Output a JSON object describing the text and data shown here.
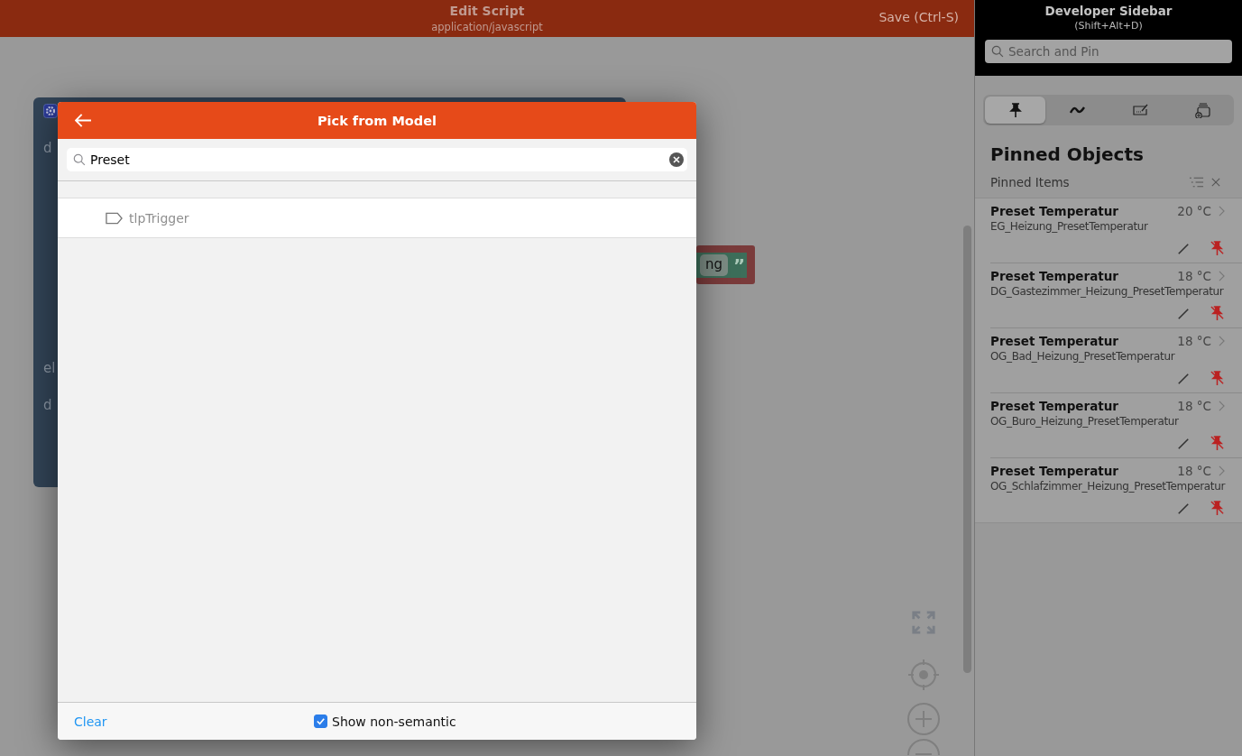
{
  "editor": {
    "title": "Edit Script",
    "subtitle": "application/javascript",
    "save_button": "Save (Ctrl-S)",
    "canvas": {
      "block_labels": [
        "d",
        "el",
        "d"
      ],
      "text_block": "ng",
      "quote": "”"
    }
  },
  "dialog": {
    "title": "Pick from Model",
    "search": {
      "value": "Preset"
    },
    "results": [
      {
        "label": "tlpTrigger"
      }
    ],
    "footer": {
      "clear": "Clear",
      "checkbox": {
        "label": "Show non-semantic",
        "checked": true
      }
    }
  },
  "sidebar": {
    "title": "Developer Sidebar",
    "shortcut": "(Shift+Alt+D)",
    "search": {
      "placeholder": "Search and Pin"
    },
    "tabs": [
      {
        "kind": "pin",
        "selected": true
      },
      {
        "kind": "wave",
        "selected": false
      },
      {
        "kind": "keyboard",
        "selected": false
      },
      {
        "kind": "stack",
        "selected": false
      }
    ],
    "heading": "Pinned Objects",
    "section": "Pinned Items",
    "items": [
      {
        "title": "Preset Temperatur",
        "value": "20 °C",
        "name": "EG_Heizung_PresetTemperatur"
      },
      {
        "title": "Preset Temperatur",
        "value": "18 °C",
        "name": "DG_Gastezimmer_Heizung_PresetTemperatur"
      },
      {
        "title": "Preset Temperatur",
        "value": "18 °C",
        "name": "OG_Bad_Heizung_PresetTemperatur"
      },
      {
        "title": "Preset Temperatur",
        "value": "18 °C",
        "name": "OG_Buro_Heizung_PresetTemperatur"
      },
      {
        "title": "Preset Temperatur",
        "value": "18 °C",
        "name": "OG_Schlafzimmer_Heizung_PresetTemperatur"
      }
    ]
  }
}
